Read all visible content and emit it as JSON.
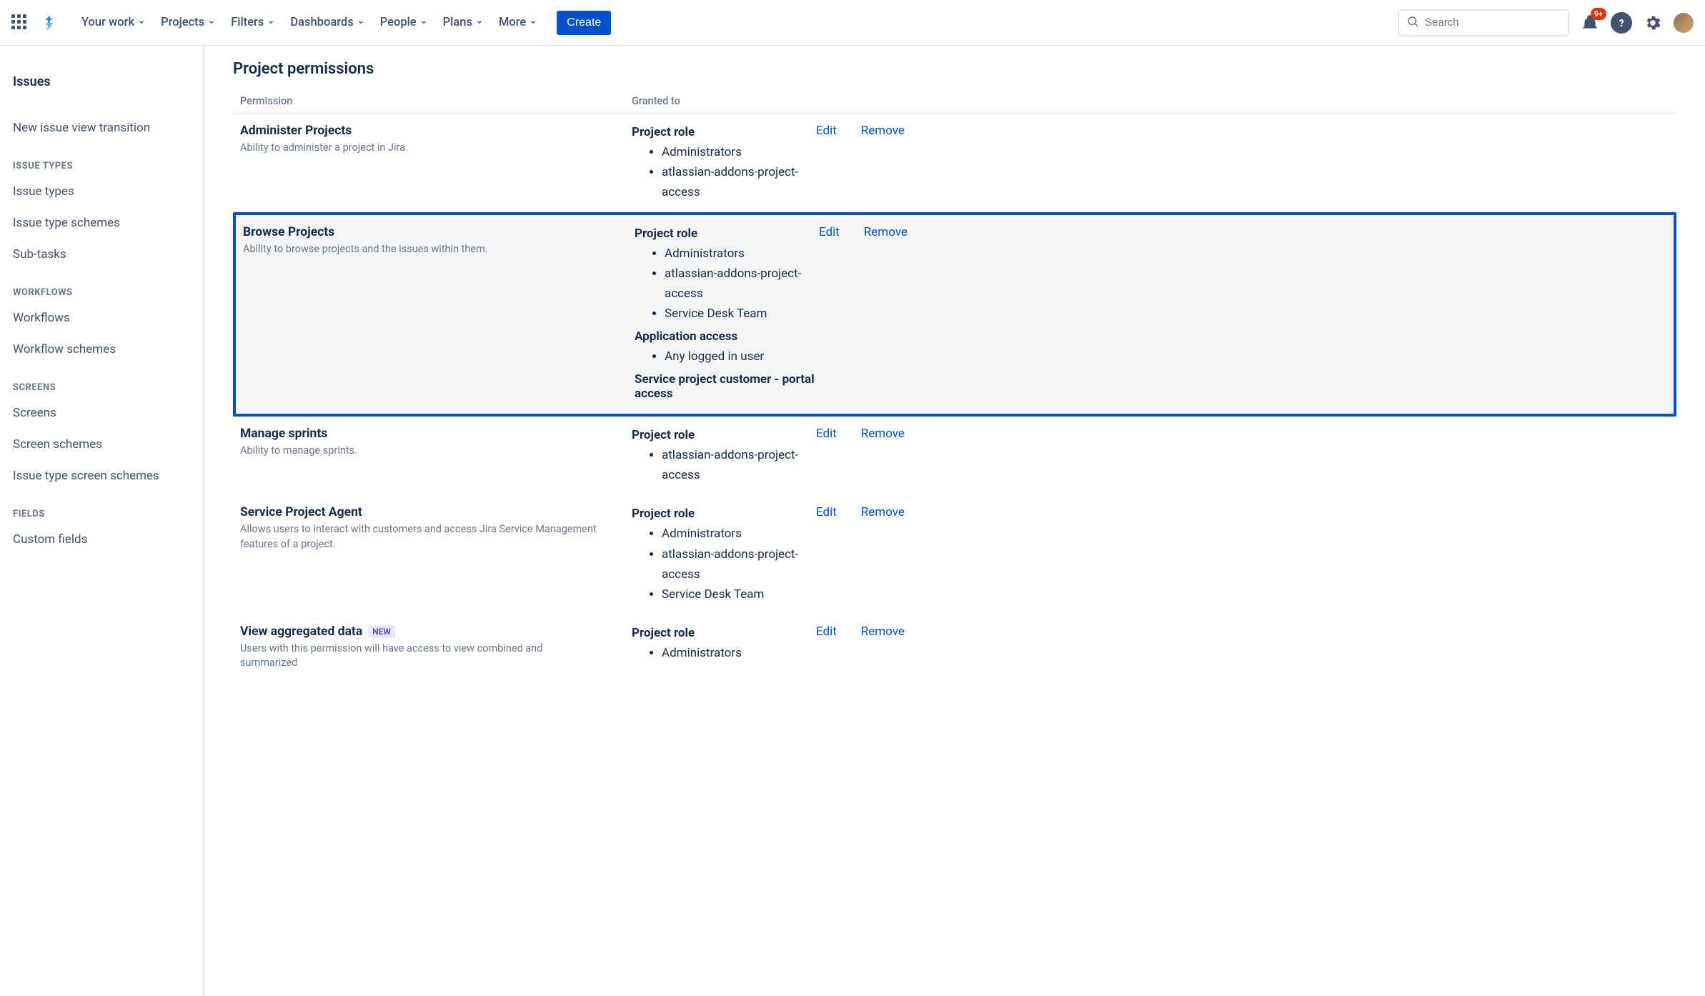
{
  "header": {
    "nav": [
      "Your work",
      "Projects",
      "Filters",
      "Dashboards",
      "People",
      "Plans",
      "More"
    ],
    "create": "Create",
    "search_placeholder": "Search",
    "notification_badge": "9+"
  },
  "sidebar": {
    "top_link": "Issues",
    "transition_link": "New issue view transition",
    "sections": [
      {
        "heading": "ISSUE TYPES",
        "items": [
          "Issue types",
          "Issue type schemes",
          "Sub-tasks"
        ]
      },
      {
        "heading": "WORKFLOWS",
        "items": [
          "Workflows",
          "Workflow schemes"
        ]
      },
      {
        "heading": "SCREENS",
        "items": [
          "Screens",
          "Screen schemes",
          "Issue type screen schemes"
        ]
      },
      {
        "heading": "FIELDS",
        "items": [
          "Custom fields"
        ]
      }
    ]
  },
  "page": {
    "title": "Project permissions",
    "col_permission": "Permission",
    "col_granted": "Granted to",
    "edit": "Edit",
    "remove": "Remove",
    "new_label": "NEW",
    "rows": [
      {
        "name": "Administer Projects",
        "desc": "Ability to administer a project in Jira.",
        "highlighted": false,
        "grants": [
          {
            "heading": "Project role",
            "items": [
              "Administrators",
              "atlassian-addons-project-access"
            ]
          }
        ]
      },
      {
        "name": "Browse Projects",
        "desc": "Ability to browse projects and the issues within them.",
        "highlighted": true,
        "grants": [
          {
            "heading": "Project role",
            "items": [
              "Administrators",
              "atlassian-addons-project-access",
              "Service Desk Team"
            ]
          },
          {
            "heading": "Application access",
            "items": [
              "Any logged in user"
            ]
          },
          {
            "heading": "Service project customer - portal access",
            "items": []
          }
        ]
      },
      {
        "name": "Manage sprints",
        "desc": "Ability to manage sprints.",
        "highlighted": false,
        "grants": [
          {
            "heading": "Project role",
            "items": [
              "atlassian-addons-project-access"
            ]
          }
        ]
      },
      {
        "name": "Service Project Agent",
        "desc": "Allows users to interact with customers and access Jira Service Management features of a project.",
        "highlighted": false,
        "grants": [
          {
            "heading": "Project role",
            "items": [
              "Administrators",
              "atlassian-addons-project-access",
              "Service Desk Team"
            ]
          }
        ]
      },
      {
        "name": "View aggregated data",
        "desc": "Users with this permission will have access to view combined and summarized",
        "highlighted": false,
        "new": true,
        "grants": [
          {
            "heading": "Project role",
            "items": [
              "Administrators"
            ]
          }
        ]
      }
    ]
  }
}
